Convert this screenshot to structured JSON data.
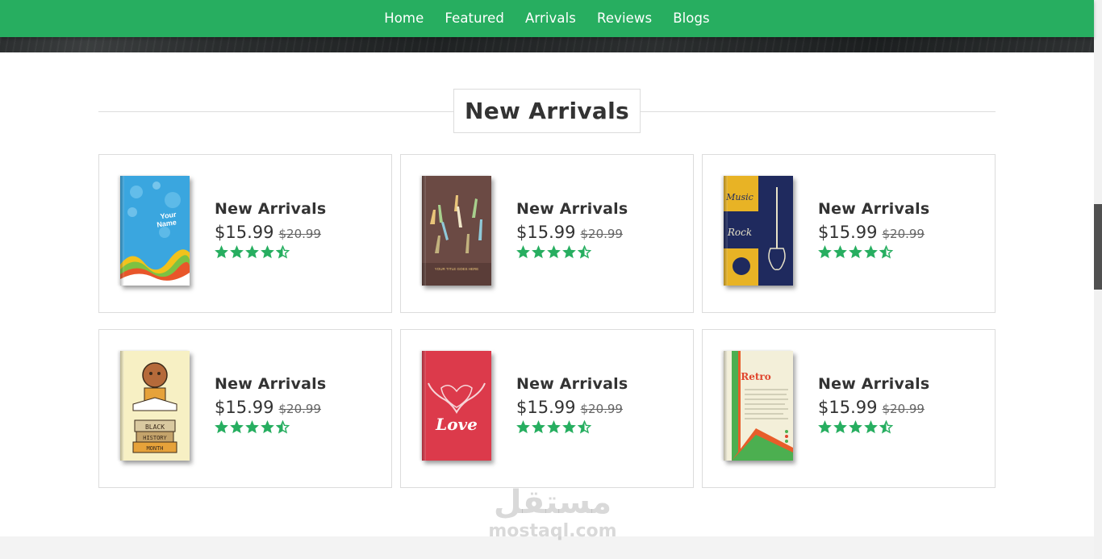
{
  "nav": {
    "items": [
      "Home",
      "Featured",
      "Arrivals",
      "Reviews",
      "Blogs"
    ]
  },
  "section": {
    "heading": "New Arrivals"
  },
  "products": [
    {
      "title": "New Arrivals",
      "price": "$15.99",
      "old_price": "$20.99",
      "rating": 4.5,
      "cover": "blue-waves",
      "cover_text": "Your Name"
    },
    {
      "title": "New Arrivals",
      "price": "$15.99",
      "old_price": "$20.99",
      "rating": 4.5,
      "cover": "hands",
      "cover_text": "YOUR TITLE GOES HERE"
    },
    {
      "title": "New Arrivals",
      "price": "$15.99",
      "old_price": "$20.99",
      "rating": 4.5,
      "cover": "music-rock",
      "cover_text": "Music Rock"
    },
    {
      "title": "New Arrivals",
      "price": "$15.99",
      "old_price": "$20.99",
      "rating": 4.5,
      "cover": "black-history",
      "cover_text": "BLACK HISTORY MONTH"
    },
    {
      "title": "New Arrivals",
      "price": "$15.99",
      "old_price": "$20.99",
      "rating": 4.5,
      "cover": "love-hands",
      "cover_text": "Love"
    },
    {
      "title": "New Arrivals",
      "price": "$15.99",
      "old_price": "$20.99",
      "rating": 4.5,
      "cover": "retro",
      "cover_text": "Retro"
    }
  ],
  "watermark": {
    "arabic": "مستقل",
    "latin": "mostaql.com"
  },
  "colors": {
    "accent": "#27ae60",
    "star": "#27ae60",
    "text": "#333333",
    "border": "#dcdcdc"
  }
}
